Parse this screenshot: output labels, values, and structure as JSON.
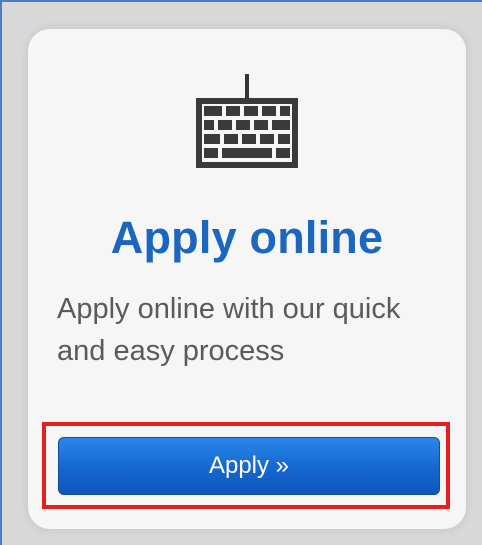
{
  "card": {
    "icon": "keyboard-icon",
    "title": "Apply online",
    "description": "Apply online with our quick and easy process",
    "button_label": "Apply »"
  },
  "colors": {
    "title": "#1b67bf",
    "button": "#1567d0",
    "highlight": "#e61e1e"
  }
}
